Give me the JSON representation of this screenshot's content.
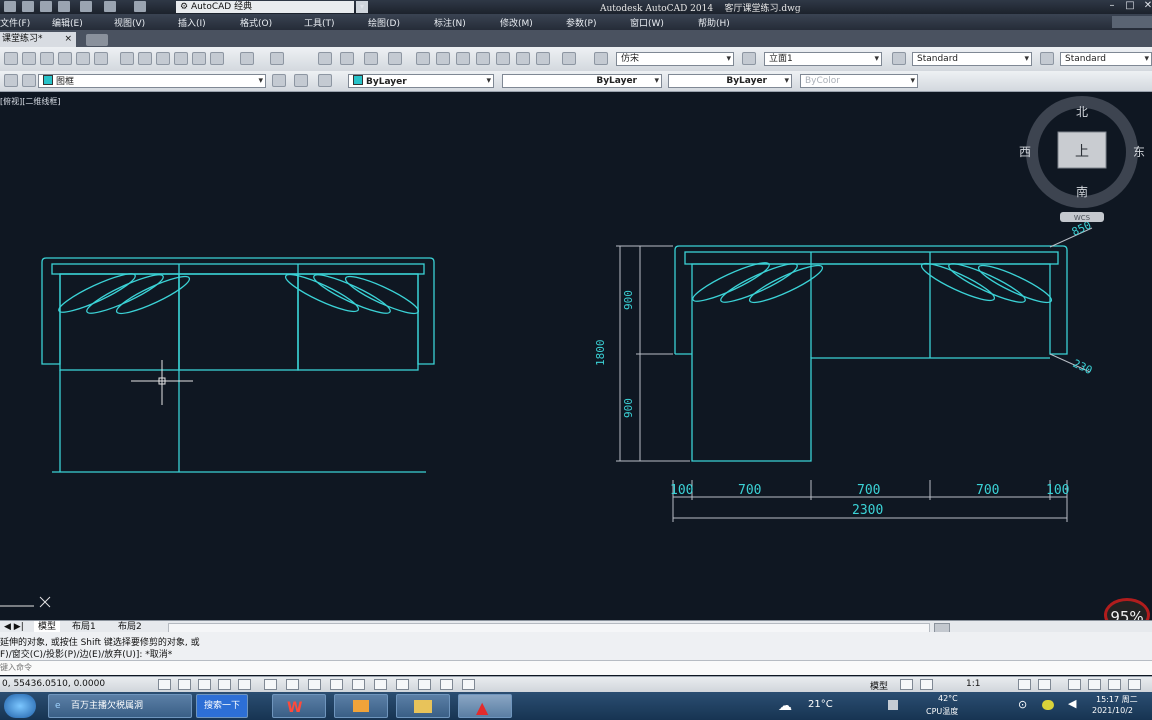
{
  "titlebar": {
    "workspace": "AutoCAD 经典",
    "app_title": "Autodesk AutoCAD 2014",
    "document": "客厅课堂练习.dwg"
  },
  "menu": {
    "items": [
      "文件(F)",
      "编辑(E)",
      "视图(V)",
      "插入(I)",
      "格式(O)",
      "工具(T)",
      "绘图(D)",
      "标注(N)",
      "修改(M)",
      "参数(P)",
      "窗口(W)",
      "帮助(H)"
    ]
  },
  "doc_tab": {
    "label": "课堂练习*",
    "close": "×"
  },
  "toolbar2": {
    "text_style": "仿宋",
    "dim_style": "立面1",
    "table_style": "Standard",
    "multileader_style": "Standard"
  },
  "toolbar3": {
    "layer": "图框",
    "color": "ByLayer",
    "linetype": "ByLayer",
    "lineweight": "ByLayer",
    "plotstyle": "ByColor"
  },
  "viewport": {
    "label": "[俯视][二维线框]"
  },
  "viewcube": {
    "north": "北",
    "south": "南",
    "east": "东",
    "west": "西",
    "face": "上",
    "wcs": "WCS"
  },
  "dimensions": {
    "top_vertical": "900",
    "bottom_vertical": "900",
    "overall_vertical": "1800",
    "seg_1": "100",
    "seg_2": "700",
    "seg_3": "700",
    "seg_4": "700",
    "seg_5": "100",
    "overall_horizontal": "2300",
    "angled_1": "850",
    "angled_2": "230"
  },
  "layout_tabs": [
    "模型",
    "布局1",
    "布局2"
  ],
  "command": {
    "line1": "延伸的对象, 或按住 Shift 键选择要修剪的对象, 或",
    "line2": "F)/窗交(C)/投影(P)/边(E)/放弃(U)]: *取消*",
    "input_placeholder": "键入命令"
  },
  "status": {
    "coordinates": "0, 55436.0510, 0.0000",
    "model": "模型",
    "scale": "1:1"
  },
  "zoom_badge": "95%",
  "taskbar": {
    "ie_task": "百万主播欠税属洞",
    "search_button": "搜索一下",
    "weather": "21°C",
    "cpu_temp": "42°C",
    "cpu_label": "CPU温度",
    "time": "15:17 周二",
    "date": "2021/10/2"
  }
}
